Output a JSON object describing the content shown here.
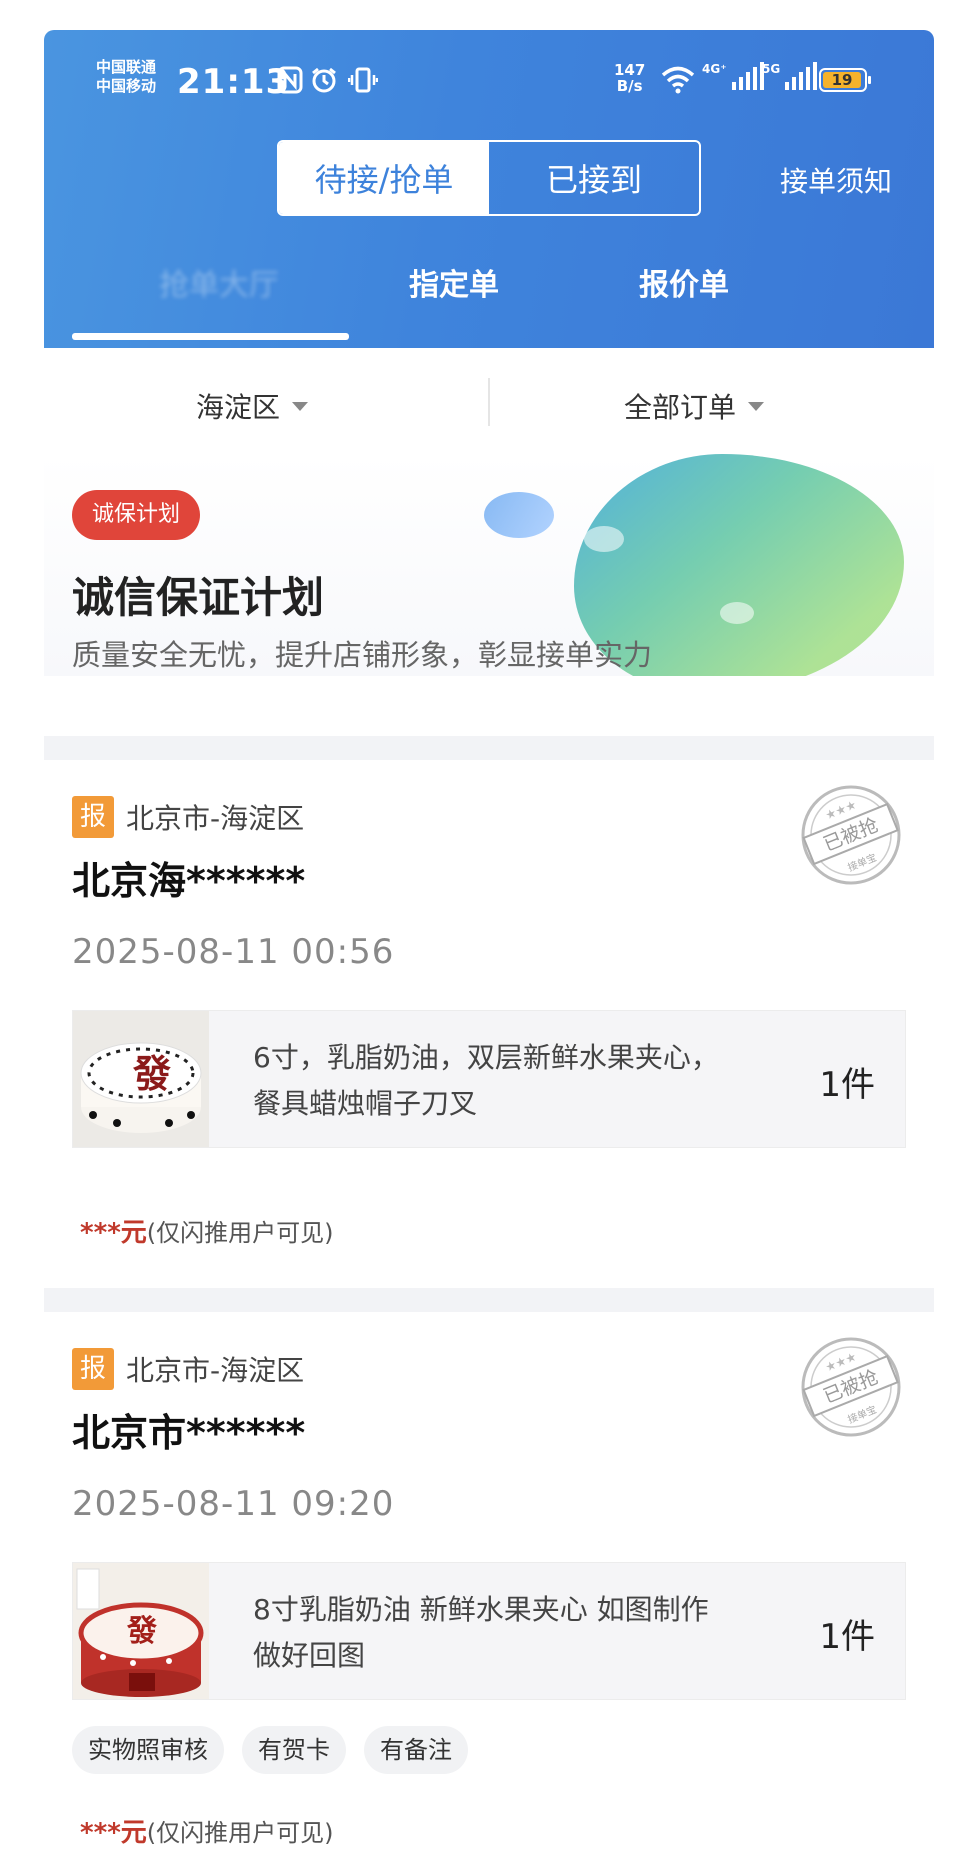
{
  "status_bar": {
    "carrier_1": "中国联通",
    "carrier_2": "中国移动",
    "time": "21:13",
    "speed_value": "147",
    "speed_unit": "B/s",
    "net_1": "4G⁺",
    "net_2": "5G",
    "battery": "19"
  },
  "top_toggle": {
    "active": "待接/抢单",
    "inactive": "已接到"
  },
  "notice_link": "接单须知",
  "tabs": {
    "hidden_tab": "抢单大厅",
    "designated": "指定单",
    "quote": "报价单"
  },
  "filters": {
    "district": "海淀区",
    "orders": "全部订单"
  },
  "banner": {
    "badge": "诚保计划",
    "title": "诚信保证计划",
    "subtitle": "质量安全无忧，提升店铺形象，彰显接单实力"
  },
  "orders": [
    {
      "tag": "报",
      "location": "北京市-海淀区",
      "name": "北京海******",
      "time": "2025-08-11 00:56",
      "desc_line1": "6寸，乳脂奶油，双层新鲜水果夹心，",
      "desc_line2": "餐具蜡烛帽子刀叉",
      "qty": "1件",
      "price_stars": "***元",
      "price_note": "(仅闪推用户可见)",
      "stamp": "已被抢",
      "stamp_sub": "接单宝",
      "tags": []
    },
    {
      "tag": "报",
      "location": "北京市-海淀区",
      "name": "北京市******",
      "time": "2025-08-11 09:20",
      "desc_line1": "8寸乳脂奶油  新鲜水果夹心 如图制作",
      "desc_line2": "做好回图",
      "qty": "1件",
      "price_stars": "***元",
      "price_note": "(仅闪推用户可见)",
      "stamp": "已被抢",
      "stamp_sub": "接单宝",
      "tags": [
        "实物照审核",
        "有贺卡",
        "有备注"
      ]
    }
  ],
  "colors": {
    "header_blue": "#3f84dc",
    "badge_red": "#e0453a",
    "tag_orange": "#f29a38",
    "price_red": "#c0392b"
  }
}
